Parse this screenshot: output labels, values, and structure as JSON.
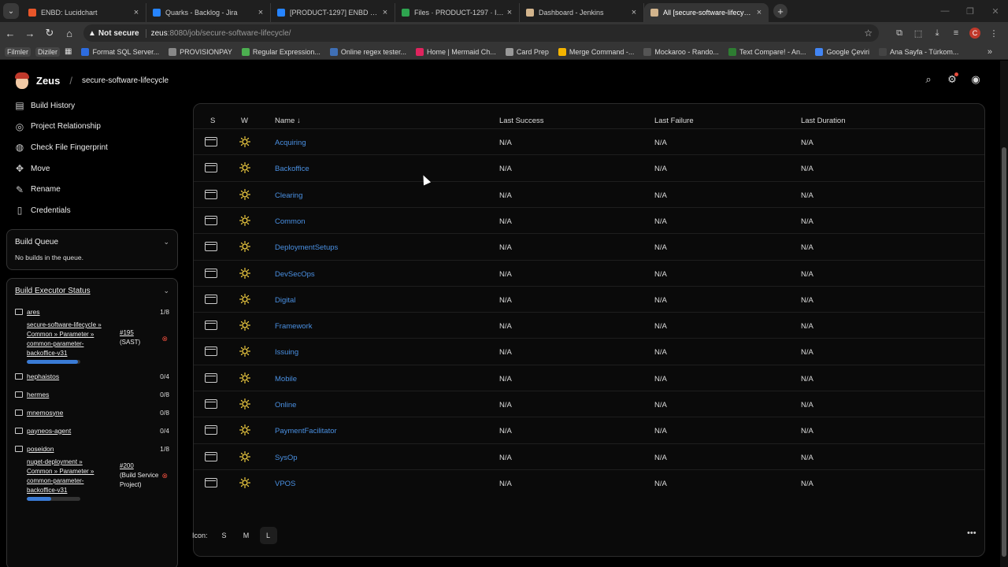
{
  "browser": {
    "tabs": [
      {
        "title": "ENBD: Lucidchart",
        "color": "#e8562a"
      },
      {
        "title": "Quarks - Backlog - Jira",
        "color": "#2684ff"
      },
      {
        "title": "[PRODUCT-1297] ENBD sunum",
        "color": "#2684ff"
      },
      {
        "title": "Files · PRODUCT-1297 · Issuing",
        "color": "#2ea44f"
      },
      {
        "title": "Dashboard - Jenkins",
        "color": "#d2b48c"
      },
      {
        "title": "All [secure-software-lifecycle]",
        "color": "#d2b48c"
      }
    ],
    "not_secure": "Not secure",
    "url_host": "zeus",
    "url_path": ":8080/job/secure-software-lifecycle/",
    "profile_letter": "C",
    "bookmarks": [
      {
        "label": "Filmler",
        "plain": true
      },
      {
        "label": "Diziler",
        "plain": true
      },
      {
        "label": "Format SQL Server...",
        "color": "#2d6cdf"
      },
      {
        "label": "PROVISIONPAY",
        "color": "#888888"
      },
      {
        "label": "Regular Expression...",
        "color": "#4caf50"
      },
      {
        "label": "Online regex tester...",
        "color": "#3f6fb5"
      },
      {
        "label": "Home | Mermaid Ch...",
        "color": "#e0245e"
      },
      {
        "label": "Card Prep",
        "color": "#999999"
      },
      {
        "label": "Merge Command -...",
        "color": "#f4b400"
      },
      {
        "label": "Mockaroo - Rando...",
        "color": "#555555"
      },
      {
        "label": "Text Compare! - An...",
        "color": "#2e7d32"
      },
      {
        "label": "Google Çeviri",
        "color": "#4285f4"
      },
      {
        "label": "Ana Sayfa - Türkom...",
        "color": "#444444"
      }
    ]
  },
  "header": {
    "brand": "Zeus",
    "crumb": "secure-software-lifecycle"
  },
  "sidenav": [
    {
      "label": "Build History",
      "icon": "history-icon",
      "glyph": "▤"
    },
    {
      "label": "Project Relationship",
      "icon": "relationship-icon",
      "glyph": "◎"
    },
    {
      "label": "Check File Fingerprint",
      "icon": "fingerprint-icon",
      "glyph": "◍"
    },
    {
      "label": "Move",
      "icon": "move-icon",
      "glyph": "✥"
    },
    {
      "label": "Rename",
      "icon": "pencil-icon",
      "glyph": "✎"
    },
    {
      "label": "Credentials",
      "icon": "credentials-icon",
      "glyph": "▯"
    }
  ],
  "build_queue": {
    "title": "Build Queue",
    "empty": "No builds in the queue."
  },
  "executors": {
    "title": "Build Executor Status",
    "nodes": [
      {
        "name": "ares",
        "count": "1/8",
        "job": {
          "name_lines": [
            "secure-software-lifecycle »",
            "Common » Parameter »",
            "common-parameter-",
            "backoffice-v31"
          ],
          "build": "#195",
          "build_sub": "(SAST)",
          "progress": 0.95
        }
      },
      {
        "name": "hephaistos",
        "count": "0/4"
      },
      {
        "name": "hermes",
        "count": "0/8"
      },
      {
        "name": "mnemosyne",
        "count": "0/8"
      },
      {
        "name": "payneos-agent",
        "count": "0/4"
      },
      {
        "name": "poseidon",
        "count": "1/8",
        "job": {
          "name_lines": [
            "nuget-deployment »",
            "Common » Parameter »",
            "common-parameter-",
            "backoffice-v31"
          ],
          "build": "#200",
          "build_sub_lines": [
            "(Build Service",
            "Project)"
          ],
          "progress": 0.45
        }
      }
    ]
  },
  "table": {
    "headers": {
      "s": "S",
      "w": "W",
      "name": "Name ↓",
      "last_success": "Last Success",
      "last_failure": "Last Failure",
      "last_duration": "Last Duration"
    },
    "rows": [
      {
        "name": "Acquiring",
        "ls": "N/A",
        "lf": "N/A",
        "ld": "N/A"
      },
      {
        "name": "Backoffice",
        "ls": "N/A",
        "lf": "N/A",
        "ld": "N/A"
      },
      {
        "name": "Clearing",
        "ls": "N/A",
        "lf": "N/A",
        "ld": "N/A"
      },
      {
        "name": "Common",
        "ls": "N/A",
        "lf": "N/A",
        "ld": "N/A"
      },
      {
        "name": "DeploymentSetups",
        "ls": "N/A",
        "lf": "N/A",
        "ld": "N/A"
      },
      {
        "name": "DevSecOps",
        "ls": "N/A",
        "lf": "N/A",
        "ld": "N/A"
      },
      {
        "name": "Digital",
        "ls": "N/A",
        "lf": "N/A",
        "ld": "N/A"
      },
      {
        "name": "Framework",
        "ls": "N/A",
        "lf": "N/A",
        "ld": "N/A"
      },
      {
        "name": "Issuing",
        "ls": "N/A",
        "lf": "N/A",
        "ld": "N/A"
      },
      {
        "name": "Mobile",
        "ls": "N/A",
        "lf": "N/A",
        "ld": "N/A"
      },
      {
        "name": "Online",
        "ls": "N/A",
        "lf": "N/A",
        "ld": "N/A"
      },
      {
        "name": "PaymentFacilitator",
        "ls": "N/A",
        "lf": "N/A",
        "ld": "N/A"
      },
      {
        "name": "SysOp",
        "ls": "N/A",
        "lf": "N/A",
        "ld": "N/A"
      },
      {
        "name": "VPOS",
        "ls": "N/A",
        "lf": "N/A",
        "ld": "N/A"
      }
    ]
  },
  "icon_size": {
    "label": "Icon:",
    "options": [
      "S",
      "M",
      "L"
    ],
    "selected": "L"
  },
  "colors": {
    "link": "#4a90e2",
    "weather_sun": "#f5d142",
    "kill": "#e74c3c",
    "progress": "#3a7bd5"
  }
}
